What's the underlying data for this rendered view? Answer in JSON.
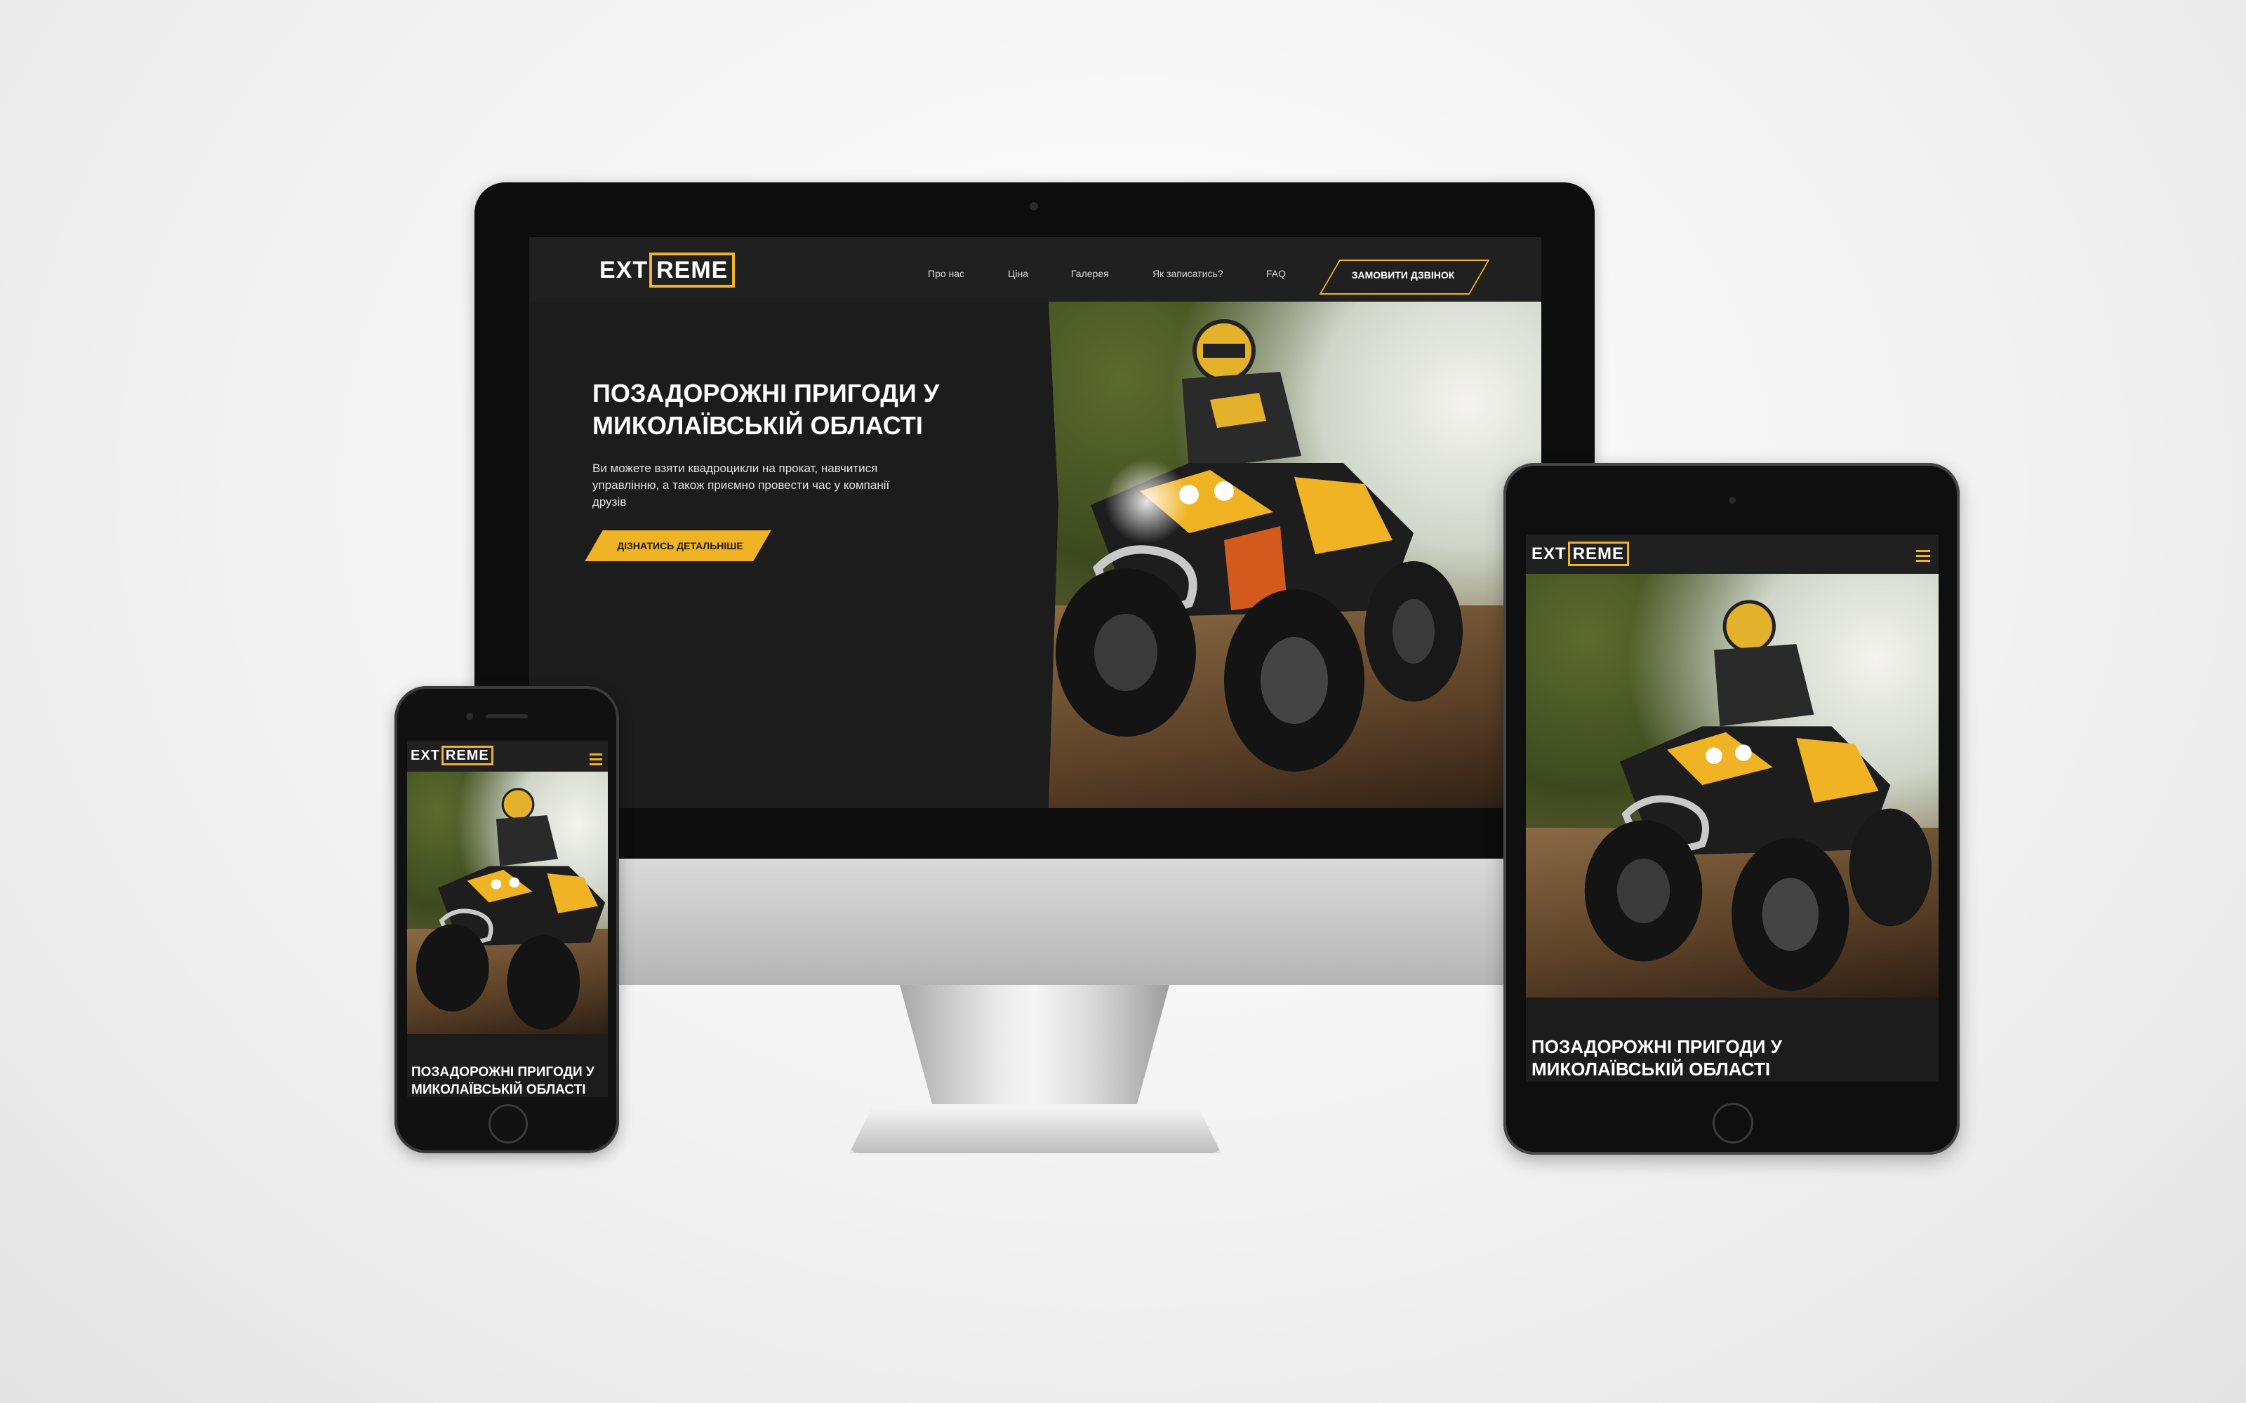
{
  "brand": {
    "logo_plain": "EXT",
    "logo_boxed": "REME",
    "accent_color": "#f0b323"
  },
  "desktop": {
    "nav": [
      "Про нас",
      "Ціна",
      "Галерея",
      "Як записатись?",
      "FAQ"
    ],
    "cta_label": "ЗАМОВИТИ ДЗВІНОК",
    "hero_title": "ПОЗАДОРОЖНІ ПРИГОДИ У МИКОЛАЇВСЬКІЙ ОБЛАСТІ",
    "hero_text": "Ви можете взяти квадроцикли на прокат, навчитися управлінню, а також приємно провести час у компанії друзів",
    "hero_button": "ДІЗНАТИСЬ ДЕТАЛЬНІШЕ"
  },
  "tablet": {
    "hero_title": "ПОЗАДОРОЖНІ ПРИГОДИ У МИКОЛАЇВСЬКІЙ ОБЛАСТІ"
  },
  "phone": {
    "hero_title": "ПОЗАДОРОЖНІ ПРИГОДИ У МИКОЛАЇВСЬКІЙ ОБЛАСТІ"
  },
  "icons": {
    "menu": "hamburger-menu-icon"
  }
}
